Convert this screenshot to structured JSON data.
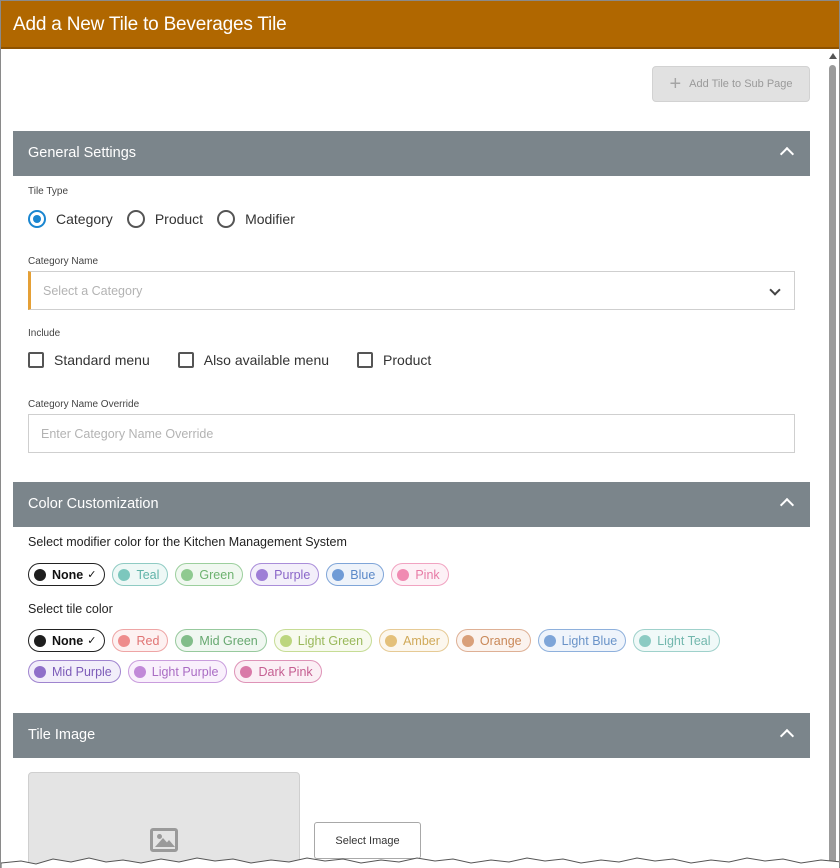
{
  "window": {
    "title": "Add a New Tile to Beverages Tile"
  },
  "toolbar": {
    "add_tile_label": "Add Tile to Sub Page",
    "add_tile_icon": "plus-icon"
  },
  "general": {
    "header": "General Settings",
    "tile_type_label": "Tile Type",
    "tile_types": [
      {
        "label": "Category",
        "checked": true
      },
      {
        "label": "Product",
        "checked": false
      },
      {
        "label": "Modifier",
        "checked": false
      }
    ],
    "category_name_label": "Category Name",
    "category_placeholder": "Select a Category",
    "include_label": "Include",
    "include_options": [
      {
        "label": "Standard menu",
        "checked": false
      },
      {
        "label": "Also available menu",
        "checked": false
      },
      {
        "label": "Product",
        "checked": false
      }
    ],
    "override_label": "Category Name Override",
    "override_placeholder": "Enter Category Name Override"
  },
  "color": {
    "header": "Color Customization",
    "kms_label": "Select modifier color for the Kitchen Management System",
    "kms_colors": [
      {
        "label": "None",
        "dot": "#1e1e1e",
        "border": "#222222",
        "bg": "#ffffff",
        "text": "#111111",
        "selected": true
      },
      {
        "label": "Teal",
        "dot": "#7cc7bd",
        "border": "#8fcbc3",
        "bg": "#eef8f6",
        "text": "#5fb3a8",
        "selected": false
      },
      {
        "label": "Green",
        "dot": "#8fca90",
        "border": "#9ccf9d",
        "bg": "#f0f8f0",
        "text": "#6db26f",
        "selected": false
      },
      {
        "label": "Purple",
        "dot": "#9e7ed6",
        "border": "#a98dd9",
        "bg": "#f3effa",
        "text": "#8a65c8",
        "selected": false
      },
      {
        "label": "Blue",
        "dot": "#6f9bd6",
        "border": "#7fa5d8",
        "bg": "#eef3fa",
        "text": "#5a88c8",
        "selected": false
      },
      {
        "label": "Pink",
        "dot": "#f08bb2",
        "border": "#f1a3c1",
        "bg": "#fdf1f6",
        "text": "#e77aa5",
        "selected": false
      }
    ],
    "tile_label": "Select tile color",
    "tile_colors": [
      {
        "label": "None",
        "dot": "#1e1e1e",
        "border": "#222222",
        "bg": "#ffffff",
        "text": "#111111",
        "selected": true
      },
      {
        "label": "Red",
        "dot": "#ee8c8c",
        "border": "#eea5a5",
        "bg": "#fdf1f1",
        "text": "#e07474",
        "selected": false
      },
      {
        "label": "Mid Green",
        "dot": "#82bd8a",
        "border": "#97c99d",
        "bg": "#f0f7f1",
        "text": "#67a870",
        "selected": false
      },
      {
        "label": "Light Green",
        "dot": "#bcd67f",
        "border": "#c6dc95",
        "bg": "#f7faee",
        "text": "#99b85a",
        "selected": false
      },
      {
        "label": "Amber",
        "dot": "#e4c07a",
        "border": "#e6ca95",
        "bg": "#fcf7ee",
        "text": "#d0a959",
        "selected": false
      },
      {
        "label": "Orange",
        "dot": "#d9a07a",
        "border": "#deb095",
        "bg": "#fbf3ee",
        "text": "#c98858",
        "selected": false
      },
      {
        "label": "Light Blue",
        "dot": "#7ea5d8",
        "border": "#8eb0dc",
        "bg": "#eff4fb",
        "text": "#6a93c8",
        "selected": false
      },
      {
        "label": "Light Teal",
        "dot": "#8ccbc3",
        "border": "#9fd1cb",
        "bg": "#f0f9f8",
        "text": "#72b7ad",
        "selected": false
      },
      {
        "label": "Mid Purple",
        "dot": "#8f6fc9",
        "border": "#9f84cf",
        "bg": "#f2eefa",
        "text": "#7c5bb8",
        "selected": false
      },
      {
        "label": "Light Purple",
        "dot": "#c189d8",
        "border": "#c99ddd",
        "bg": "#f9f0fc",
        "text": "#aa6cc4",
        "selected": false
      },
      {
        "label": "Dark Pink",
        "dot": "#d97aa8",
        "border": "#de93b7",
        "bg": "#fbeff5",
        "text": "#c55e91",
        "selected": false
      }
    ]
  },
  "image": {
    "header": "Tile Image",
    "select_label": "Select Image",
    "placeholder_icon": "image-icon"
  }
}
